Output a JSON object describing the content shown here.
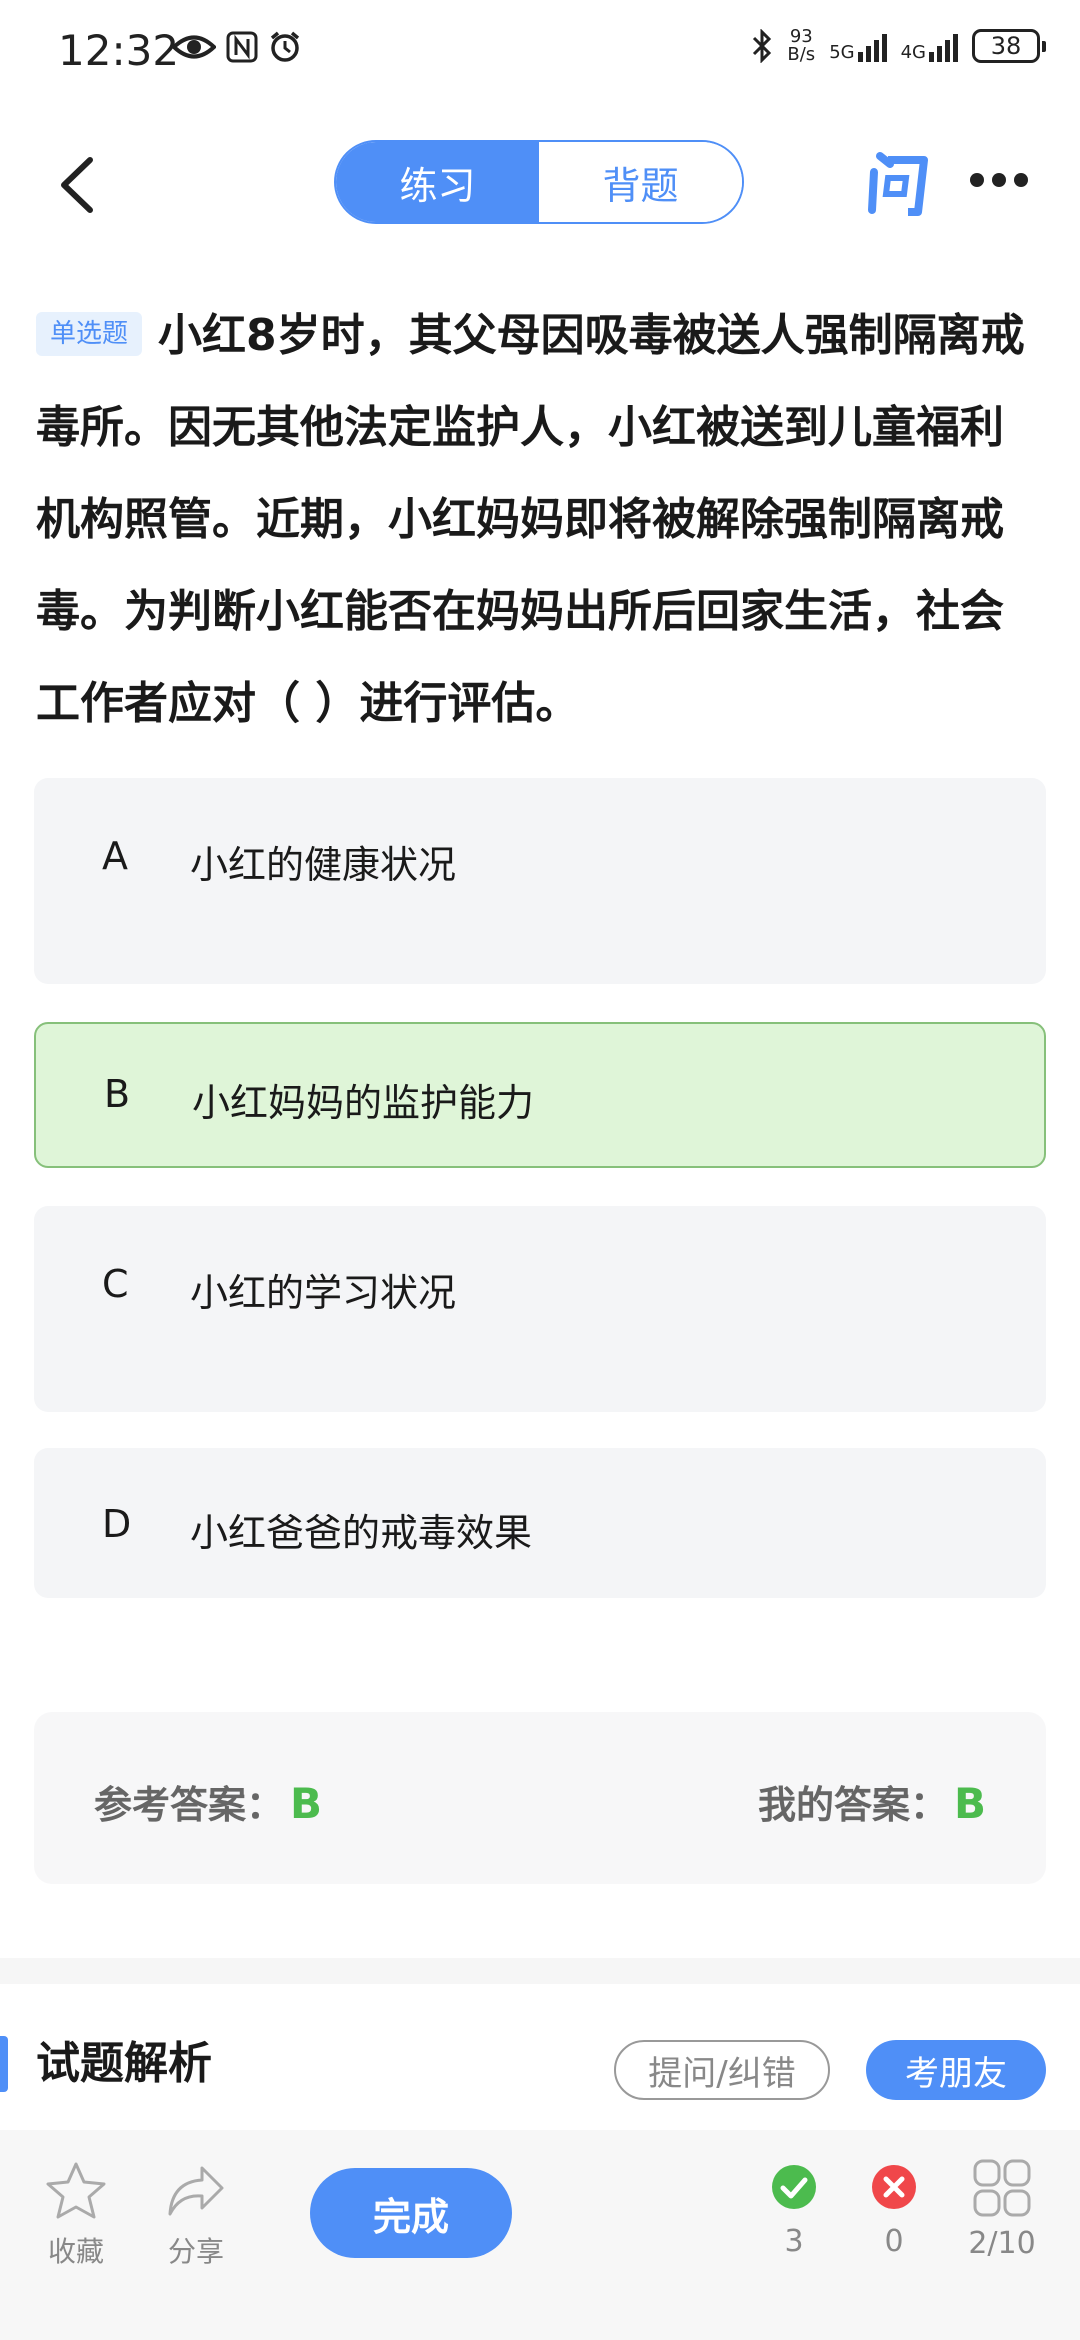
{
  "status_bar": {
    "time": "12:32",
    "speed_value": "93",
    "speed_unit": "B/s",
    "net1": "5G",
    "net2": "4G",
    "battery": "38"
  },
  "header": {
    "tabs": [
      {
        "label": "练习",
        "active": true
      },
      {
        "label": "背题",
        "active": false
      }
    ]
  },
  "question": {
    "type_tag": "单选题",
    "text": "小红8岁时，其父母因吸毒被送人强制隔离戒毒所。因无其他法定监护人，小红被送到儿童福利机构照管。近期，小红妈妈即将被解除强制隔离戒毒。为判断小红能否在妈妈出所后回家生活，社会工作者应对（ ）进行评估。",
    "options": [
      {
        "letter": "A",
        "text": "小红的健康状况",
        "state": "normal"
      },
      {
        "letter": "B",
        "text": "小红妈妈的监护能力",
        "state": "correct"
      },
      {
        "letter": "C",
        "text": "小红的学习状况",
        "state": "normal"
      },
      {
        "letter": "D",
        "text": "小红爸爸的戒毒效果",
        "state": "normal"
      }
    ]
  },
  "answer": {
    "reference_label": "参考答案：",
    "reference_value": "B",
    "mine_label": "我的答案：",
    "mine_value": "B"
  },
  "analysis": {
    "title": "试题解析",
    "ask_button": "提问/纠错",
    "friend_button": "考朋友"
  },
  "bottom_bar": {
    "favorite": "收藏",
    "share": "分享",
    "finish": "完成",
    "correct_count": "3",
    "wrong_count": "0",
    "progress": "2/10"
  },
  "colors": {
    "accent": "#4f8ff7",
    "correct": "#4cbb4e",
    "wrong": "#f0474a",
    "correct_bg": "#dff5d8"
  }
}
